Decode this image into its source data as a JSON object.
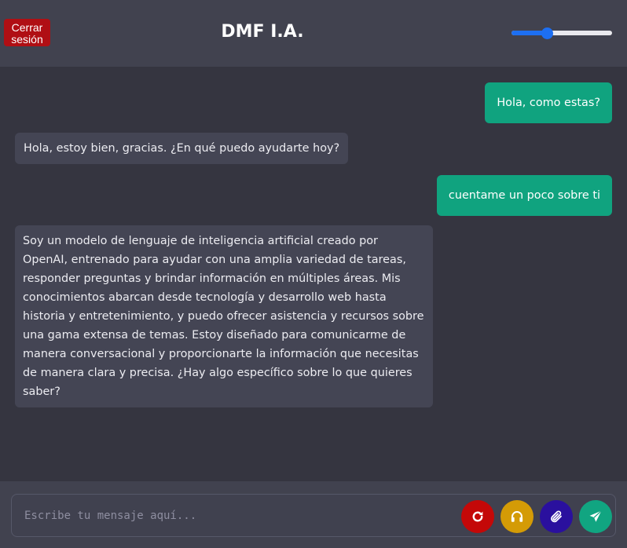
{
  "header": {
    "logout_label": "Cerrar sesión",
    "title": "DMF I.A.",
    "volume_level": 0.35
  },
  "messages": [
    {
      "role": "user",
      "text": "Hola, como estas?"
    },
    {
      "role": "bot",
      "text": "Hola, estoy bien, gracias. ¿En qué puedo ayudarte hoy?"
    },
    {
      "role": "user",
      "text": "cuentame un poco sobre ti"
    },
    {
      "role": "bot",
      "text": "Soy un modelo de lenguaje de inteligencia artificial creado por OpenAI, entrenado para ayudar con una amplia variedad de tareas, responder preguntas y brindar información en múltiples áreas. Mis conocimientos abarcan desde tecnología y desarrollo web hasta historia y entretenimiento, y puedo ofrecer asistencia y recursos sobre una gama extensa de temas. Estoy diseñado para comunicarme de manera conversacional y proporcionarte la información que necesitas de manera clara y precisa. ¿Hay algo específico sobre lo que quieres saber?"
    }
  ],
  "composer": {
    "placeholder": "Escribe tu mensaje aquí...",
    "buttons": [
      {
        "icon": "refresh-icon",
        "color": "#c40808"
      },
      {
        "icon": "headphones-icon",
        "color": "#d49b06"
      },
      {
        "icon": "paperclip-icon",
        "color": "#2a109e"
      },
      {
        "icon": "send-icon",
        "color": "#11a581"
      }
    ]
  },
  "colors": {
    "header_bg": "#41424f",
    "chat_bg": "#353540",
    "user_bubble": "#10a37f",
    "bot_bubble": "#444554",
    "logout_bg": "#b00f14",
    "slider_accent": "#1d6ff2"
  }
}
